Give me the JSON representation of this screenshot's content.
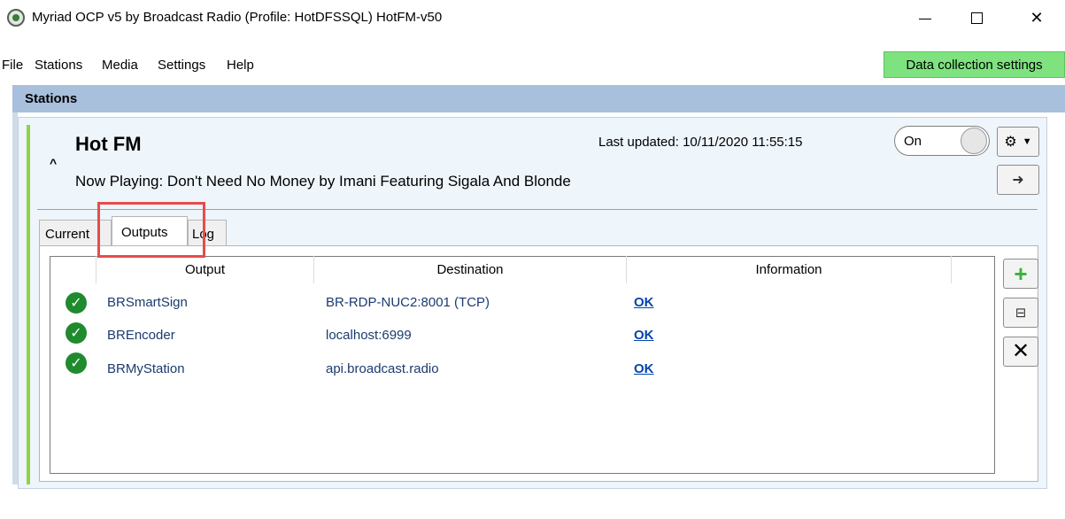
{
  "window": {
    "title": "Myriad OCP v5 by Broadcast Radio (Profile: HotDFSSQL) HotFM-v50"
  },
  "menu": [
    {
      "label": "File"
    },
    {
      "label": "Stations"
    },
    {
      "label": "Media"
    },
    {
      "label": "Settings"
    },
    {
      "label": "Help"
    }
  ],
  "data_collection_label": "Data collection settings",
  "stations_panel": {
    "title": "Stations"
  },
  "station": {
    "name": "Hot FM",
    "last_updated": "Last updated: 10/11/2020 11:55:15",
    "toggle_label": "On",
    "now_playing": "Now Playing:  Don't Need No Money by Imani Featuring Sigala And Blonde"
  },
  "tabs": [
    {
      "label": "Current"
    },
    {
      "label": "Outputs"
    },
    {
      "label": "Log"
    }
  ],
  "table": {
    "headers": [
      "",
      "Output",
      "Destination",
      "Information"
    ],
    "rows": [
      {
        "output": "BRSmartSign",
        "destination": "BR-RDP-NUC2:8001 (TCP)",
        "info": "OK"
      },
      {
        "output": "BREncoder",
        "destination": "localhost:6999",
        "info": "OK"
      },
      {
        "output": "BRMyStation",
        "destination": "api.broadcast.radio",
        "info": "OK"
      }
    ]
  },
  "colors": {
    "data_collection_bg": "#7ee27e",
    "stations_header_bg": "#a8c0dc",
    "station_accent": "#8fd445",
    "highlight": "#e74c4c",
    "link": "#0645ad"
  },
  "icons": [
    "app-icon",
    "minimize-icon",
    "maximize-icon",
    "close-icon",
    "collapse-chevron-icon",
    "gear-icon",
    "chevron-down-icon",
    "arrow-circle-icon",
    "check-circle-icon",
    "add-icon",
    "edit-icon",
    "delete-icon"
  ]
}
